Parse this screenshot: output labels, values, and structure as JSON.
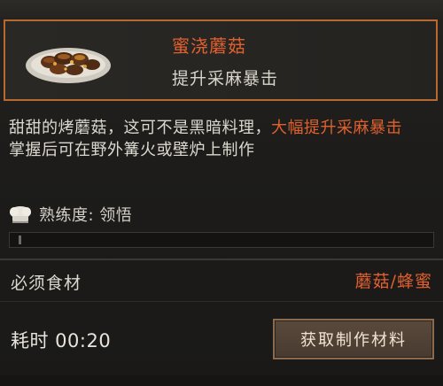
{
  "recipe": {
    "name": "蜜浇蘑菇",
    "effect": "提升采麻暴击",
    "description_parts": {
      "normal": "甜甜的烤蘑菇，这可不是黑暗料理，",
      "highlight": "大幅提升采麻暴击"
    },
    "learn_hint": "掌握后可在野外篝火或壁炉上制作",
    "proficiency_label": "熟练度: 领悟",
    "proficiency_progress": 0
  },
  "ingredients": {
    "label": "必须食材",
    "value": "蘑菇/蜂蜜"
  },
  "time": {
    "label": "耗时 00:20"
  },
  "actions": {
    "obtain_materials": "获取制作材料"
  },
  "colors": {
    "accent": "#e0602f",
    "border": "#b9692f",
    "text": "#dcd8cf",
    "background": "#1c1b19"
  },
  "icons": {
    "dish": "mushroom-dish-icon",
    "proficiency": "chef-hat-icon"
  }
}
